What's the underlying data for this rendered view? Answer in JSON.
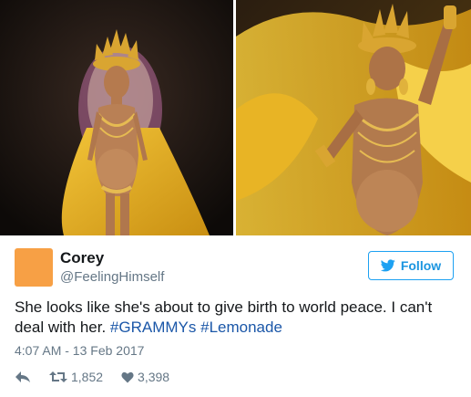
{
  "tweet": {
    "author_name": "Corey",
    "author_handle": "@FeelingHimself",
    "follow_label": "Follow",
    "text_plain": "She looks like she's about to give birth to world peace. I can't deal with her. ",
    "hashtag_1": "#GRAMMYs",
    "hashtag_2": "#Lemonade",
    "timestamp": "4:07 AM - 13 Feb 2017",
    "retweets": "1,852",
    "likes": "3,398"
  },
  "colors": {
    "avatar": "#f7a045",
    "brand_blue": "#1da1f2",
    "hashtag": "#1b57a8",
    "secondary_text": "#657786"
  },
  "icons": {
    "follow": "twitter-bird-icon",
    "reply": "reply-icon",
    "retweet": "retweet-icon",
    "like": "heart-icon"
  }
}
